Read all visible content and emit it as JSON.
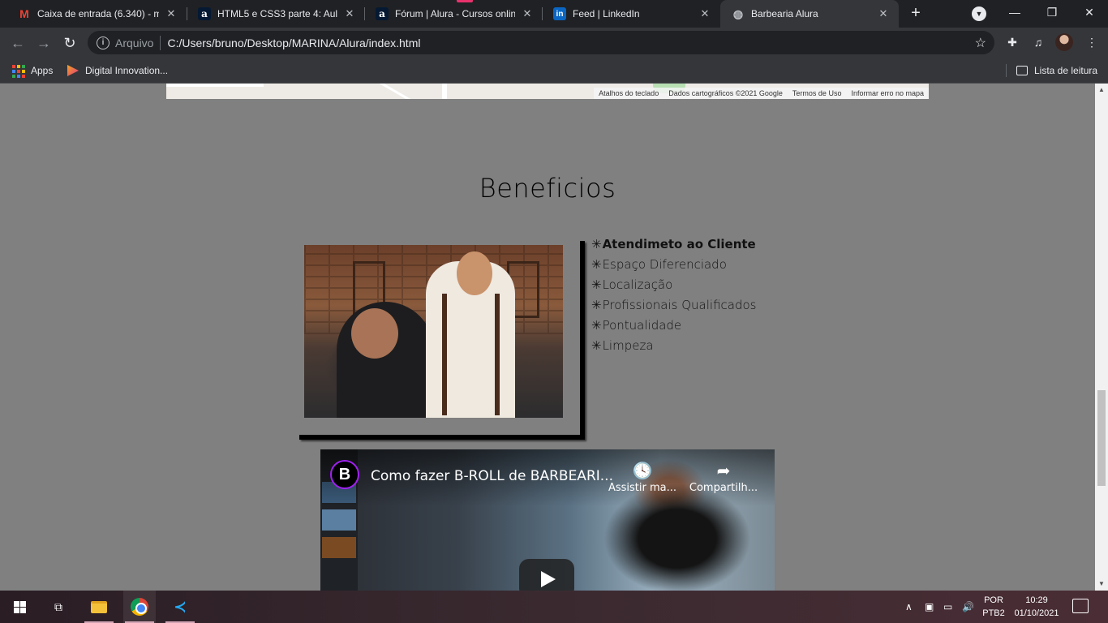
{
  "browser": {
    "tabs": [
      {
        "title": "Caixa de entrada (6.340) - ma",
        "favicon": "gmail-icon",
        "active": false
      },
      {
        "title": "HTML5 e CSS3 parte 4: Aula 5",
        "favicon": "alura-icon",
        "active": false
      },
      {
        "title": "Fórum | Alura - Cursos online",
        "favicon": "alura-icon",
        "active": false
      },
      {
        "title": "Feed | LinkedIn",
        "favicon": "linkedin-icon",
        "active": false
      },
      {
        "title": "Barbearia Alura",
        "favicon": "globe-icon",
        "active": true
      }
    ],
    "omnibox": {
      "security_label": "Arquivo",
      "url": "C:/Users/bruno/Desktop/MARINA/Alura/index.html"
    },
    "bookmarks": [
      {
        "label": "Apps",
        "icon": "apps-grid-icon"
      },
      {
        "label": "Digital Innovation...",
        "icon": "dio-icon"
      }
    ],
    "reading_list_label": "Lista de leitura"
  },
  "page": {
    "map_attribution": [
      "Atalhos do teclado",
      "Dados cartográficos ©2021 Google",
      "Termos de Uso",
      "Informar erro no mapa"
    ],
    "benefits_heading": "Beneficios",
    "benefits": [
      "Atendimeto ao Cliente",
      "Espaço Diferenciado",
      "Localização",
      "Profissionais Qualificados",
      "Pontualidade",
      "Limpeza"
    ],
    "bullet_glyph": "✳",
    "video": {
      "title": "Como fazer B-ROLL de BARBEARI...",
      "watch_later": "Assistir ma...",
      "share": "Compartilh...",
      "channel_logo_letter": "B"
    }
  },
  "taskbar": {
    "language": "POR",
    "keyboard": "PTB2",
    "time": "10:29",
    "date": "01/10/2021"
  },
  "colors": {
    "page_background": "#808080",
    "chrome_dark": "#202124",
    "chrome_toolbar": "#35363a"
  }
}
